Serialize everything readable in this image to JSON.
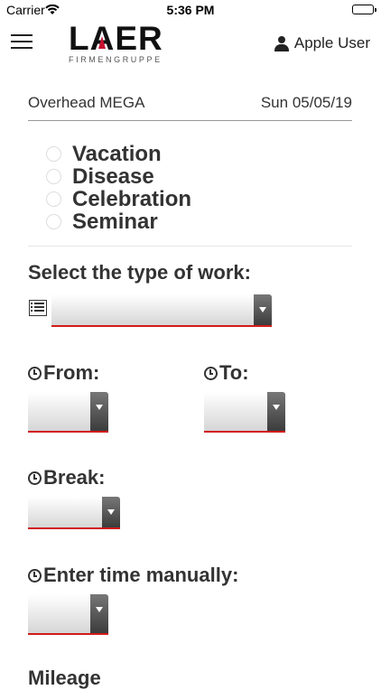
{
  "status_bar": {
    "carrier": "Carrier",
    "time": "5:36 PM"
  },
  "header": {
    "logo_main": "LAER",
    "logo_sub": "FIRMENGRUPPE",
    "user_name": "Apple User",
    "accent_color": "#c8102e"
  },
  "info": {
    "project": "Overhead MEGA",
    "date": "Sun 05/05/19"
  },
  "absence_options": [
    {
      "label": "Vacation"
    },
    {
      "label": "Disease"
    },
    {
      "label": "Celebration"
    },
    {
      "label": "Seminar"
    }
  ],
  "work_type": {
    "label": "Select the type of work:",
    "value": ""
  },
  "from": {
    "label": "From:",
    "value": ""
  },
  "to": {
    "label": "To:",
    "value": ""
  },
  "break": {
    "label": "Break:",
    "value": ""
  },
  "manual_time": {
    "label": "Enter time manually:",
    "value": ""
  },
  "mileage": {
    "label": "Mileage"
  }
}
